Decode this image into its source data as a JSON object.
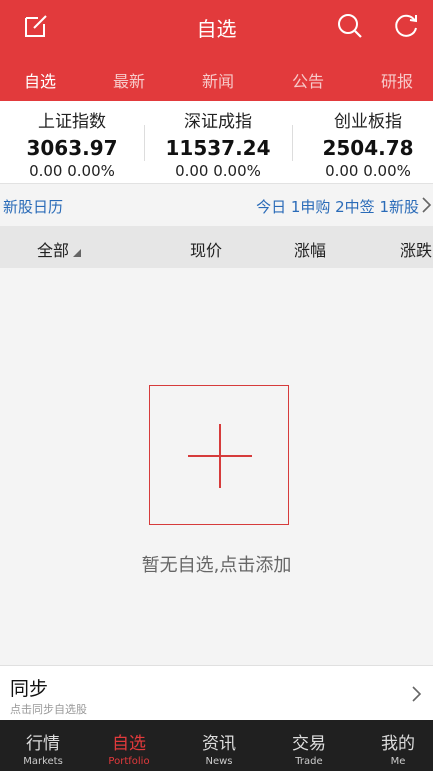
{
  "header": {
    "title": "自选",
    "icons": [
      "edit-icon",
      "search-icon",
      "refresh-icon"
    ]
  },
  "tabs": [
    {
      "label": "自选",
      "active": true
    },
    {
      "label": "最新",
      "active": false
    },
    {
      "label": "新闻",
      "active": false
    },
    {
      "label": "公告",
      "active": false
    },
    {
      "label": "研报",
      "active": false
    }
  ],
  "indices": [
    {
      "name": "上证指数",
      "value": "3063.97",
      "change": "0.00 0.00%"
    },
    {
      "name": "深证成指",
      "value": "11537.24",
      "change": "0.00 0.00%"
    },
    {
      "name": "创业板指",
      "value": "2504.78",
      "change": "0.00 0.00%"
    }
  ],
  "ipo_calendar": {
    "label": "新股日历",
    "summary": "今日 1申购 2中签 1新股"
  },
  "columns": [
    "全部",
    "现价",
    "涨幅",
    "涨跌"
  ],
  "empty_state": {
    "text": "暂无自选,点击添加"
  },
  "sync": {
    "title": "同步",
    "subtitle": "点击同步自选股"
  },
  "bottom_nav": [
    {
      "zh": "行情",
      "en": "Markets",
      "active": false
    },
    {
      "zh": "自选",
      "en": "Portfolio",
      "active": true
    },
    {
      "zh": "资讯",
      "en": "News",
      "active": false
    },
    {
      "zh": "交易",
      "en": "Trade",
      "active": false
    },
    {
      "zh": "我的",
      "en": "Me",
      "active": false
    }
  ],
  "colors": {
    "brand_red": "#e23a3c",
    "link_blue": "#2a6bb8",
    "nav_bg": "#202020"
  }
}
